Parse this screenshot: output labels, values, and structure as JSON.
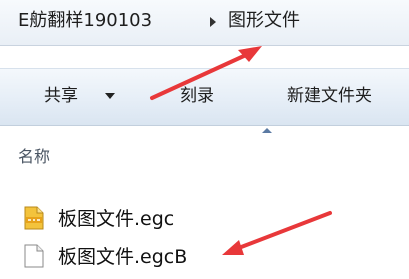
{
  "address": {
    "crumbs": [
      "E舫翻样190103",
      "图形文件"
    ]
  },
  "toolbar": {
    "share_label": "共享",
    "burn_label": "刻录",
    "new_folder_label": "新建文件夹"
  },
  "columns": {
    "name_label": "名称"
  },
  "files": [
    {
      "name": "板图文件.egc",
      "icon": "egc-file-icon"
    },
    {
      "name": "板图文件.egcB",
      "icon": "blank-file-icon"
    }
  ],
  "annotation_color": "#e8383a"
}
